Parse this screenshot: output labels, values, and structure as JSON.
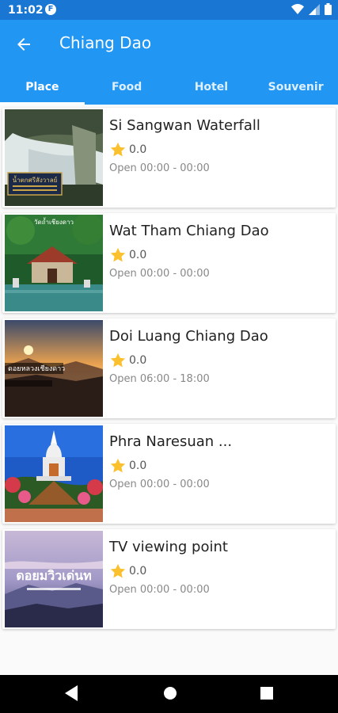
{
  "status": {
    "time": "11:02",
    "app_icon": "F"
  },
  "header": {
    "title": "Chiang Dao"
  },
  "tabs": [
    {
      "label": "Place",
      "active": true
    },
    {
      "label": "Food",
      "active": false
    },
    {
      "label": "Hotel",
      "active": false
    },
    {
      "label": "Souvenir",
      "active": false
    }
  ],
  "places": [
    {
      "name": "Si Sangwan Waterfall",
      "rating": "0.0",
      "hours": "Open 00:00 - 00:00",
      "image": "waterfall",
      "thumb_text": "น้ำตกศรีสังวาลย์"
    },
    {
      "name": "Wat Tham Chiang Dao",
      "rating": "0.0",
      "hours": "Open 00:00 - 00:00",
      "image": "temple",
      "thumb_text": "วัดถ้ำเชียงดาว"
    },
    {
      "name": "Doi Luang Chiang Dao",
      "rating": "0.0",
      "hours": "Open 06:00 - 18:00",
      "image": "mountain-sunrise",
      "thumb_text": "ดอยหลวงเชียงดาว"
    },
    {
      "name": "Phra Naresuan ...",
      "rating": "0.0",
      "hours": "Open 00:00 - 00:00",
      "image": "pagoda",
      "thumb_text": ""
    },
    {
      "name": "TV viewing point",
      "rating": "0.0",
      "hours": "Open 00:00 - 00:00",
      "image": "viewpoint",
      "thumb_text": "ดอยมวิวเด่นท"
    }
  ],
  "colors": {
    "primary": "#2196f3",
    "primary_dark": "#1976d2",
    "star": "#fbc02d"
  }
}
